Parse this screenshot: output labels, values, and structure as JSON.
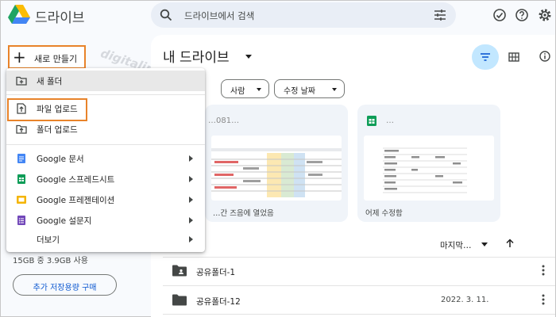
{
  "app": {
    "title": "드라이브"
  },
  "search": {
    "placeholder": "드라이브에서 검색"
  },
  "main": {
    "title": "내 드라이브",
    "chips": [
      {
        "label": "사람"
      },
      {
        "label": "수정 날짜"
      }
    ],
    "cards": [
      {
        "title": "…081…",
        "footer": "…간 즈음에 열었음",
        "type": "spreadsheet"
      },
      {
        "title": "…",
        "footer": "어제 수정함",
        "type": "spreadsheet"
      }
    ],
    "sort": {
      "label": "마지막…"
    },
    "files": [
      {
        "name": "공유폴더-1",
        "date": "",
        "icon": "shared-folder-icon"
      },
      {
        "name": "공유폴더-12",
        "date": "2022. 3. 11.",
        "icon": "folder-icon"
      }
    ]
  },
  "sidebar": {
    "new_button": "새로 만들기",
    "storage": "15GB 중 3.9GB 사용",
    "buy_storage": "추가 저장용량 구매",
    "watermark": "digitaline"
  },
  "new_menu": {
    "items": [
      {
        "label": "새 폴더",
        "icon": "new-folder-icon",
        "submenu": false,
        "highlighted": true
      },
      {
        "label": "파일 업로드",
        "icon": "file-upload-icon",
        "submenu": false,
        "highlighted": false
      },
      {
        "label": "폴더 업로드",
        "icon": "folder-upload-icon",
        "submenu": false,
        "highlighted": false
      },
      {
        "label": "Google 문서",
        "icon": "google-docs-icon",
        "submenu": true
      },
      {
        "label": "Google 스프레드시트",
        "icon": "google-sheets-icon",
        "submenu": true
      },
      {
        "label": "Google 프레젠테이션",
        "icon": "google-slides-icon",
        "submenu": true
      },
      {
        "label": "Google 설문지",
        "icon": "google-forms-icon",
        "submenu": true
      },
      {
        "label": "더보기",
        "icon": "",
        "submenu": true
      }
    ]
  },
  "colors": {
    "accent": "#0b57d0",
    "highlight_box": "#e8832a",
    "docs": "#4285f4",
    "sheets": "#0f9d58",
    "slides": "#f4b400",
    "forms": "#7248b9"
  }
}
